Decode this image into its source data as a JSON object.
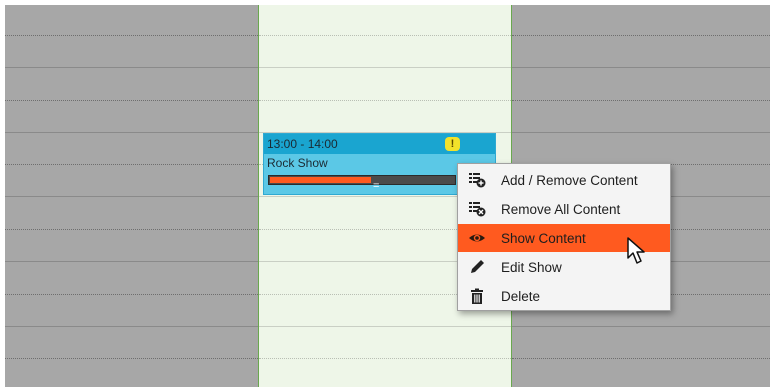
{
  "event": {
    "time": "13:00 - 14:00",
    "title": "Rock Show",
    "warning_glyph": "!",
    "warning_icon": "warning-icon",
    "progress": 0.55,
    "handle_glyph": "=",
    "colors": {
      "header": "#1aa5d0",
      "body": "#5bc8e6",
      "progress": "#ff5a1f"
    }
  },
  "context_menu": {
    "items": [
      {
        "label": "Add / Remove Content",
        "icon": "add-content-icon",
        "active": false
      },
      {
        "label": "Remove All Content",
        "icon": "remove-content-icon",
        "active": false
      },
      {
        "label": "Show Content",
        "icon": "eye-icon",
        "active": true
      },
      {
        "label": "Edit Show",
        "icon": "pencil-icon",
        "active": false
      },
      {
        "label": "Delete",
        "icon": "trash-icon",
        "active": false
      }
    ],
    "highlight_color": "#ff5a1f"
  },
  "calendar": {
    "today_color": "#eef6e8",
    "other_day_color": "#a7a7a7"
  }
}
